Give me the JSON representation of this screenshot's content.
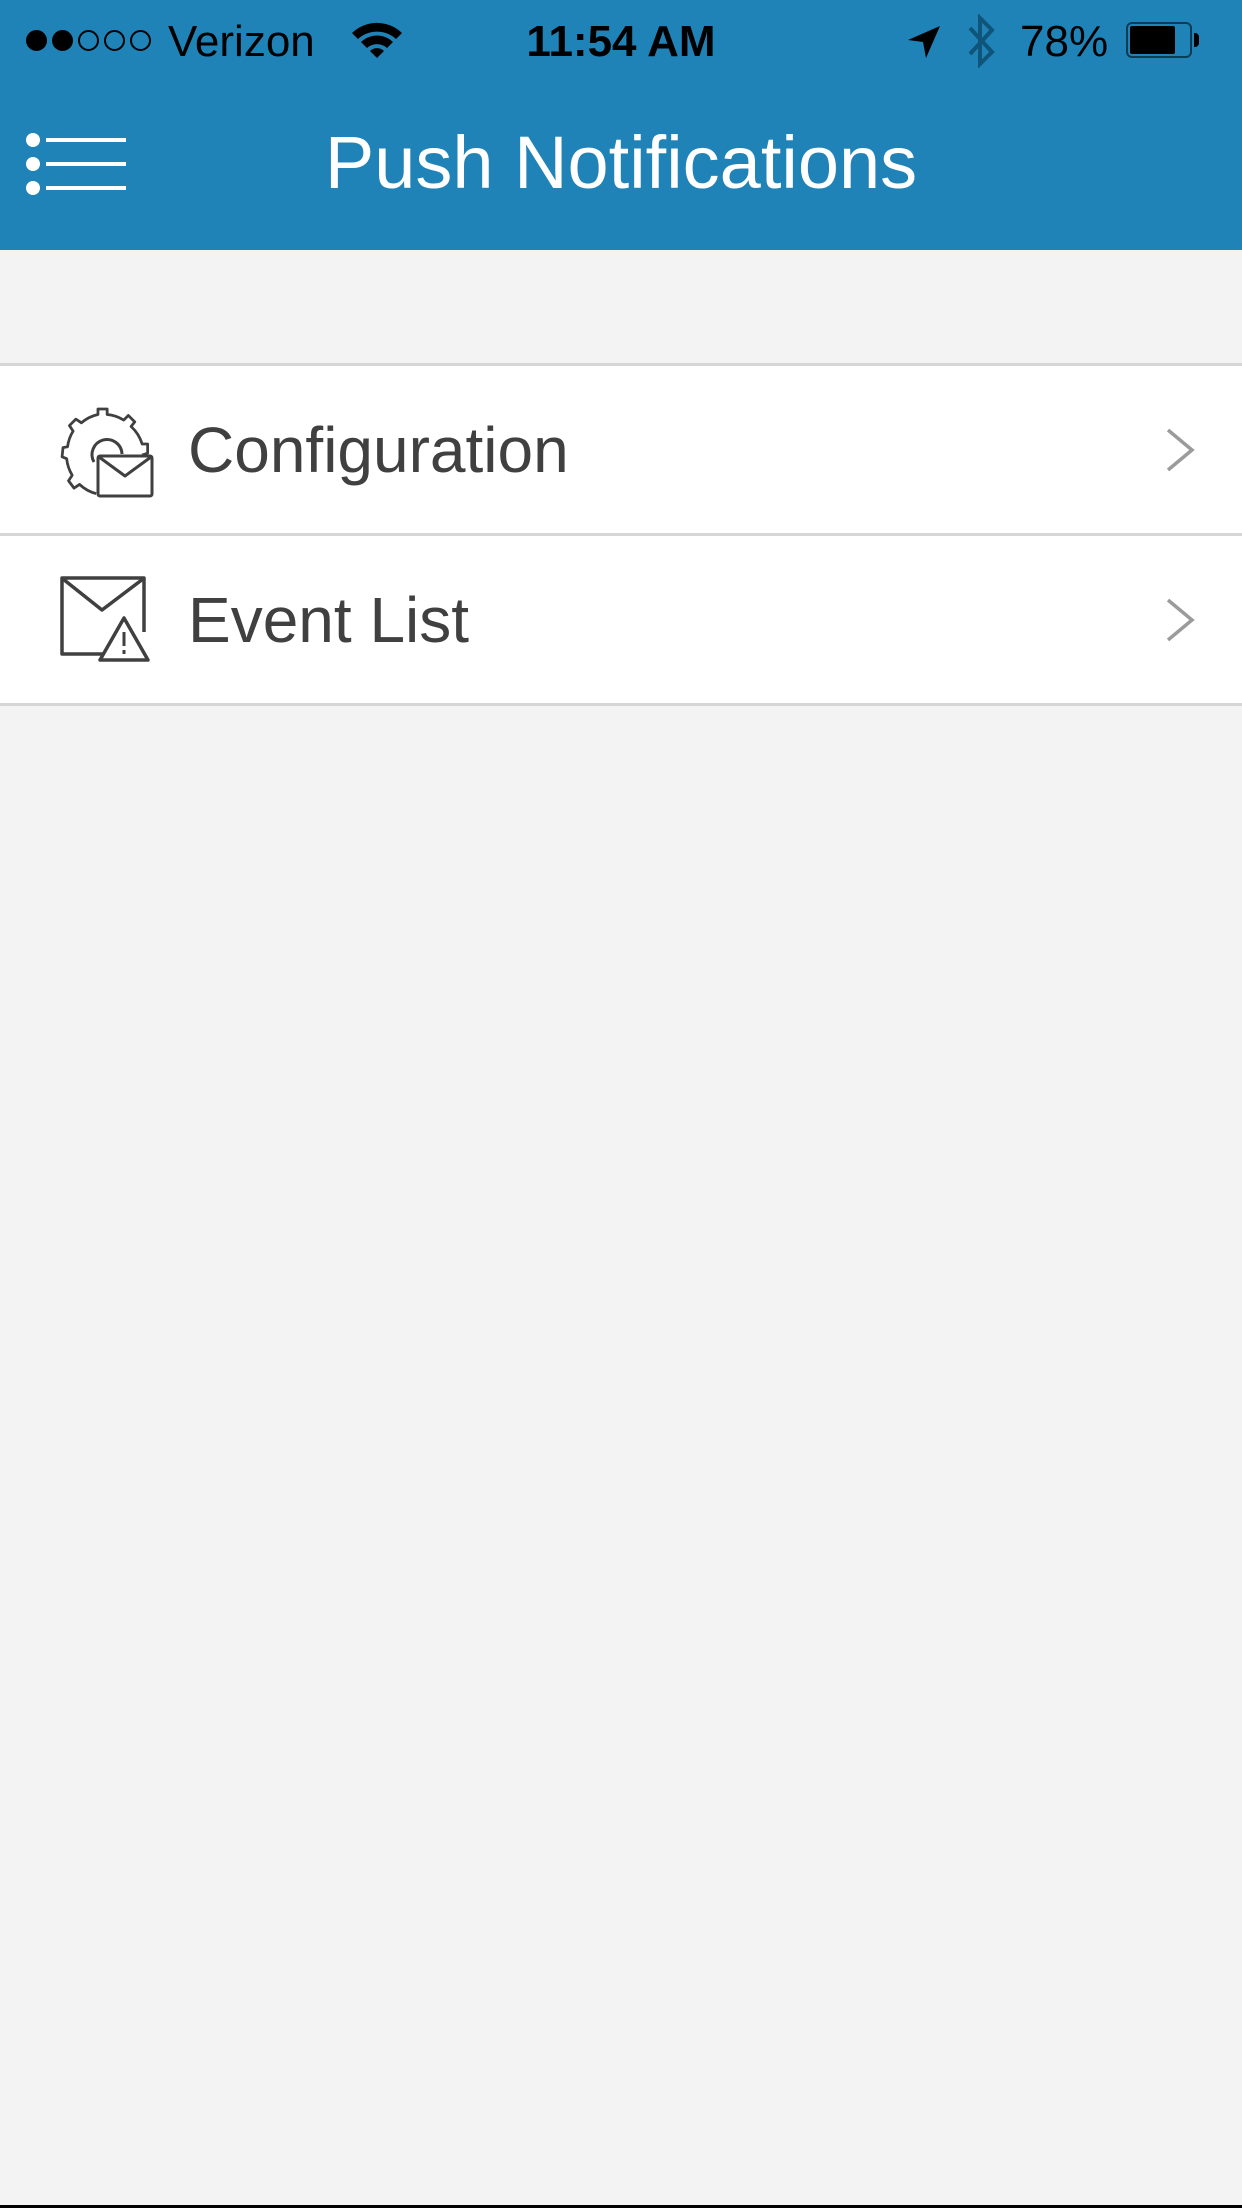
{
  "status_bar": {
    "signal_strength": {
      "filled": 2,
      "total": 5
    },
    "carrier": "Verizon",
    "wifi_icon": "wifi-icon",
    "time": "11:54 AM",
    "location_icon": "location-arrow-icon",
    "bluetooth_icon": "bluetooth-icon",
    "battery_percent_text": "78%",
    "battery_level": 0.78
  },
  "header": {
    "menu_icon": "list-menu-icon",
    "title": "Push Notifications",
    "background_color": "#1f83b7"
  },
  "menu": {
    "items": [
      {
        "label": "Configuration",
        "icon": "gear-envelope-icon"
      },
      {
        "label": "Event List",
        "icon": "envelope-warning-icon"
      }
    ]
  },
  "colors": {
    "header_bg": "#1f83b7",
    "page_bg": "#f3f3f3",
    "row_bg": "#ffffff",
    "text": "#404040",
    "separator": "#d6d6d6"
  }
}
